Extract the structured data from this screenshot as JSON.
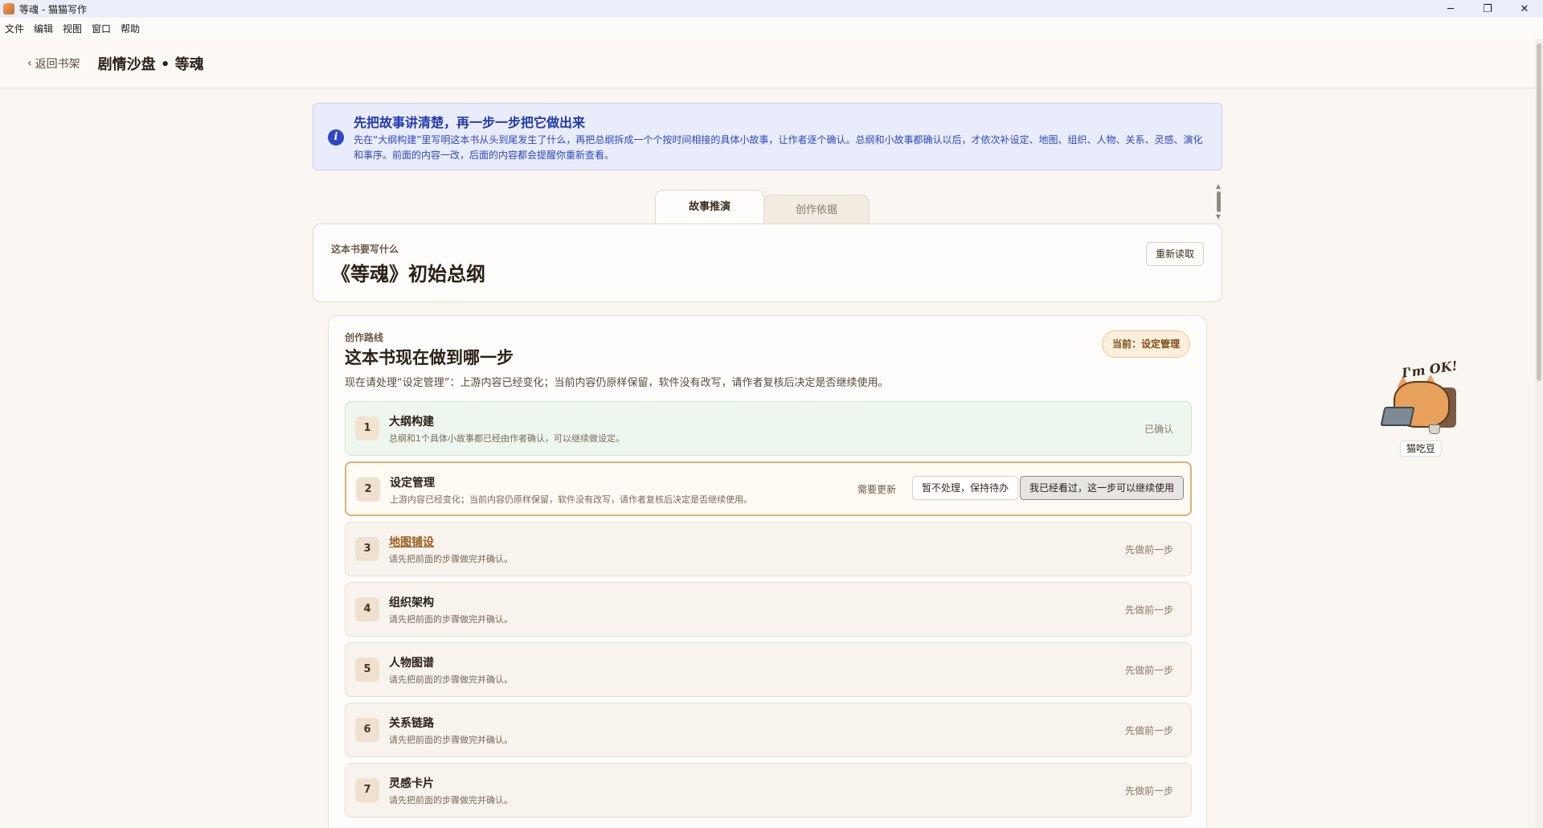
{
  "window": {
    "title": "等魂 - 猫猫写作",
    "controls": [
      "─",
      "❐",
      "✕"
    ]
  },
  "menubar": [
    "文件",
    "编辑",
    "视图",
    "窗口",
    "帮助"
  ],
  "header": {
    "back_label": "返回书架",
    "title": "剧情沙盘 • 等魂"
  },
  "banner": {
    "title": "先把故事讲清楚，再一步一步把它做出来",
    "text": "先在“大纲构建”里写明这本书从头到尾发生了什么，再把总纲拆成一个个按时间相接的具体小故事，让作者逐个确认。总纲和小故事都确认以后，才依次补设定、地图、组织、人物、关系、灵感、演化和事序。前面的内容一改，后面的内容都会提醒你重新查看。",
    "accent_color": "#2f47c4"
  },
  "tabs": [
    {
      "label": "故事推演",
      "active": true
    },
    {
      "label": "创作依据",
      "active": false
    }
  ],
  "outline": {
    "eyebrow": "这本书要写什么",
    "title": "《等魂》初始总纲",
    "reload_label": "重新读取"
  },
  "route": {
    "eyebrow": "创作路线",
    "title": "这本书现在做到哪一步",
    "description": "现在请处理“设定管理”：上游内容已经变化；当前内容仍原样保留，软件没有改写，请作者复核后决定是否继续使用。",
    "current_badge": "当前：设定管理",
    "steps": [
      {
        "num": "1",
        "title": "大纲构建",
        "desc": "总纲和1个具体小故事都已经由作者确认，可以继续做设定。",
        "status": "已确认",
        "state": "done"
      },
      {
        "num": "2",
        "title": "设定管理",
        "desc": "上游内容已经变化；当前内容仍原样保留，软件没有改写，请作者复核后决定是否继续使用。",
        "status": "需要更新",
        "state": "current",
        "btn_later": "暂不处理，保持待办",
        "btn_ok": "我已经看过，这一步可以继续使用"
      },
      {
        "num": "3",
        "title": "地图铺设",
        "desc": "请先把前面的步骤做完并确认。",
        "status": "先做前一步",
        "state": "locked",
        "link": true
      },
      {
        "num": "4",
        "title": "组织架构",
        "desc": "请先把前面的步骤做完并确认。",
        "status": "先做前一步",
        "state": "locked"
      },
      {
        "num": "5",
        "title": "人物图谱",
        "desc": "请先把前面的步骤做完并确认。",
        "status": "先做前一步",
        "state": "locked"
      },
      {
        "num": "6",
        "title": "关系链路",
        "desc": "请先把前面的步骤做完并确认。",
        "status": "先做前一步",
        "state": "locked"
      },
      {
        "num": "7",
        "title": "灵感卡片",
        "desc": "请先把前面的步骤做完并确认。",
        "status": "先做前一步",
        "state": "locked"
      }
    ]
  },
  "mascot": {
    "bubble": "I'm OK!",
    "name": "猫吃豆"
  }
}
